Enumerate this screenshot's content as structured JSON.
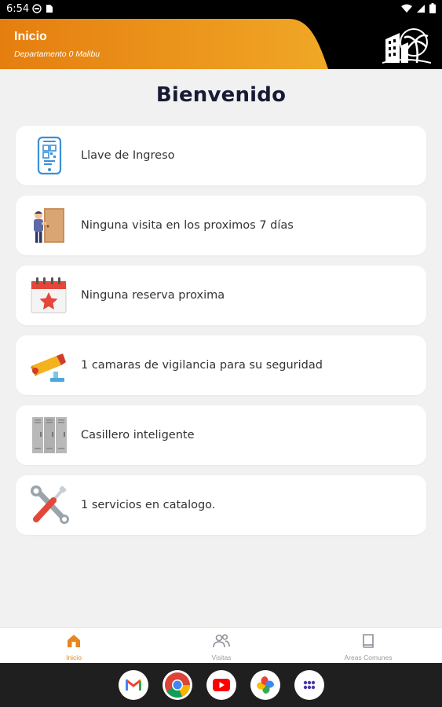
{
  "status_bar": {
    "time": "6:54"
  },
  "header": {
    "title": "Inicio",
    "subtitle": "Departamento 0 Malibu",
    "accent_color": "#e8861b"
  },
  "main": {
    "title": "Bienvenido",
    "cards": [
      {
        "icon": "smartphone-qr-icon",
        "label": "Llave de Ingreso"
      },
      {
        "icon": "visitor-door-icon",
        "label": "Ninguna visita en los proximos 7 días"
      },
      {
        "icon": "calendar-star-icon",
        "label": "Ninguna reserva proxima"
      },
      {
        "icon": "security-camera-icon",
        "label": "1 camaras de vigilancia para su seguridad"
      },
      {
        "icon": "lockers-icon",
        "label": "Casillero inteligente"
      },
      {
        "icon": "tools-icon",
        "label": "1 servicios en catalogo."
      }
    ]
  },
  "bottom_nav": {
    "items": [
      {
        "icon": "home-icon",
        "label": "Inicio",
        "active": true
      },
      {
        "icon": "people-icon",
        "label": "Visitas",
        "active": false
      },
      {
        "icon": "book-icon",
        "label": "Areas Comunes",
        "active": false
      }
    ]
  },
  "dock": {
    "apps": [
      "gmail-icon",
      "chrome-icon",
      "youtube-icon",
      "photos-icon",
      "app-drawer-icon"
    ]
  }
}
